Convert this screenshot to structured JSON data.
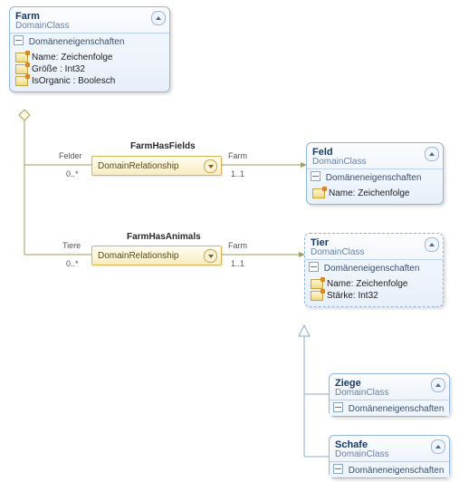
{
  "farm": {
    "title": "Farm",
    "stereo": "DomainClass",
    "compHeader": "Domäneneigenschaften",
    "props": [
      "Name: Zeichenfolge",
      "Größe : Int32",
      "IsOrganic : Boolesch"
    ]
  },
  "rel1": {
    "header": "FarmHasFields",
    "stereo": "DomainRelationship",
    "leftRole": "Felder",
    "leftMult": "0..*",
    "rightRole": "Farm",
    "rightMult": "1..1"
  },
  "feld": {
    "title": "Feld",
    "stereo": "DomainClass",
    "compHeader": "Domäneneigenschaften",
    "props": [
      "Name: Zeichenfolge"
    ]
  },
  "rel2": {
    "header": "FarmHasAnimals",
    "stereo": "DomainRelationship",
    "leftRole": "Tiere",
    "leftMult": "0..*",
    "rightRole": "Farm",
    "rightMult": "1..1"
  },
  "tier": {
    "title": "Tier",
    "stereo": "DomainClass",
    "compHeader": "Domäneneigenschaften",
    "props": [
      "Name: Zeichenfolge",
      "Stärke: Int32"
    ]
  },
  "ziege": {
    "title": "Ziege",
    "stereo": "DomainClass",
    "compHeader": "Domäneneigenschaften"
  },
  "schafe": {
    "title": "Schafe",
    "stereo": "DomainClass",
    "compHeader": "Domäneneigenschaften"
  }
}
